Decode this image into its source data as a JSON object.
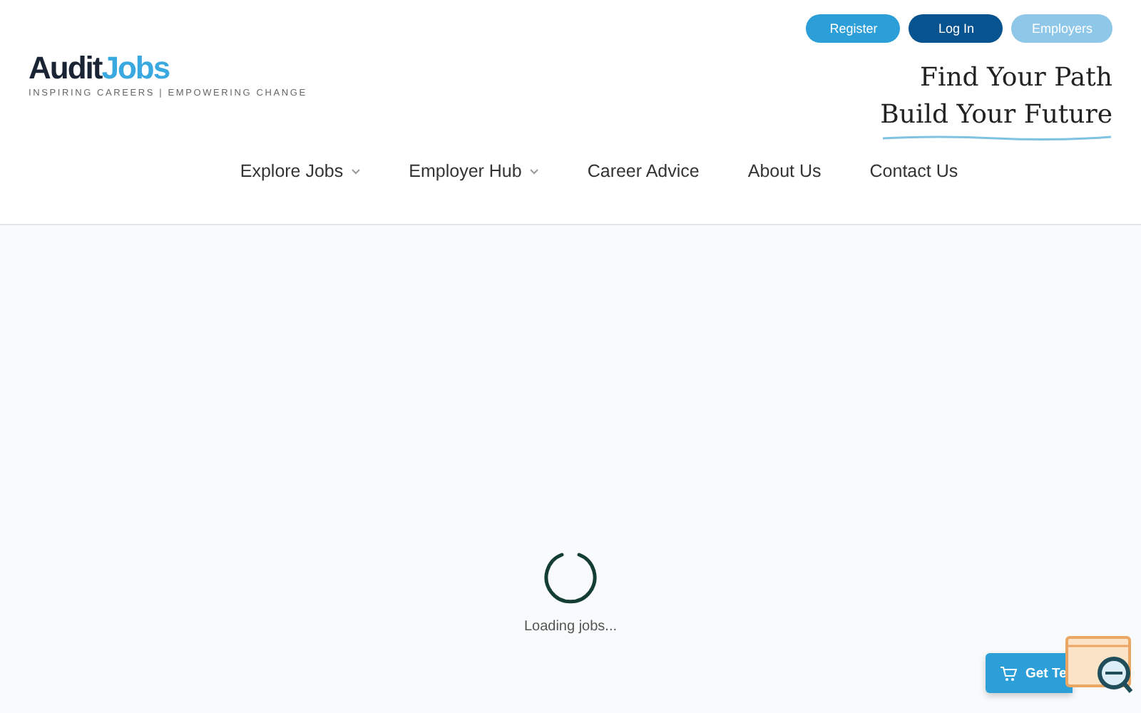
{
  "logo": {
    "brand_primary": "Audit",
    "brand_accent": "Jobs",
    "tagline": "INSPIRING CAREERS | EMPOWERING CHANGE"
  },
  "auth_buttons": [
    {
      "label": "Register",
      "kind": "primary"
    },
    {
      "label": "Log In",
      "kind": "dark"
    },
    {
      "label": "Employers",
      "kind": "light"
    }
  ],
  "slogan": [
    "Find Your Path",
    "Build Your Future"
  ],
  "nav": [
    {
      "label": "Explore Jobs",
      "dropdown": true
    },
    {
      "label": "Employer Hub",
      "dropdown": true
    },
    {
      "label": "Career Advice",
      "dropdown": false
    },
    {
      "label": "About Us",
      "dropdown": false
    },
    {
      "label": "Contact Us",
      "dropdown": false
    }
  ],
  "loading": {
    "text": "Loading jobs..."
  },
  "cart_button": {
    "label": "Get Te"
  }
}
